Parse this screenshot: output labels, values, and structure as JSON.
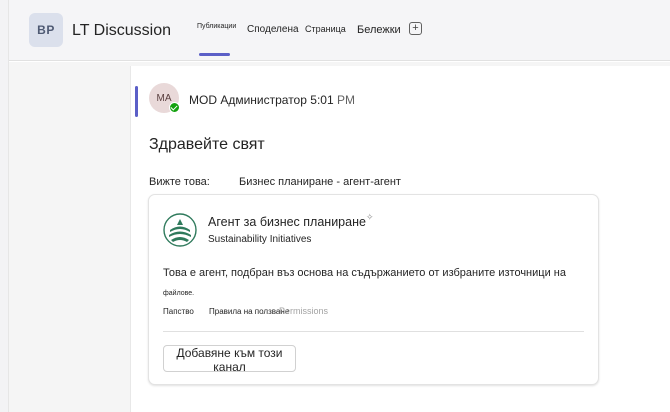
{
  "header": {
    "team_initials": "BP",
    "channel_title": "LT Discussion",
    "tabs": [
      {
        "label": "Публикации"
      },
      {
        "label": "Споделена"
      },
      {
        "label": "Страница"
      },
      {
        "label": "Бележки"
      }
    ],
    "add_tab_glyph": "+"
  },
  "post": {
    "author_initials": "MA",
    "author_name": "MOD Администратор",
    "time": "5:01",
    "ampm": "PM",
    "title": "Здравейте свят",
    "see_label": "Вижте това:",
    "see_link": "Бизнес планиране - агент-агент"
  },
  "card": {
    "agent_name": "Агент за бизнес планиране",
    "sparkle": "✧",
    "subtitle": "Sustainability Initiatives",
    "description": "Това е агент, подбран въз основа на съдържанието от избраните източници на",
    "description_cont": "файлове.",
    "links": [
      {
        "label": "Папство"
      },
      {
        "label": "Правила на ползване"
      },
      {
        "label": "Permissions"
      }
    ],
    "add_button": "Добавяне към този канал"
  },
  "colors": {
    "accent": "#5b5fc7",
    "presence": "#13a10e",
    "logo": "#2f7a5c"
  }
}
